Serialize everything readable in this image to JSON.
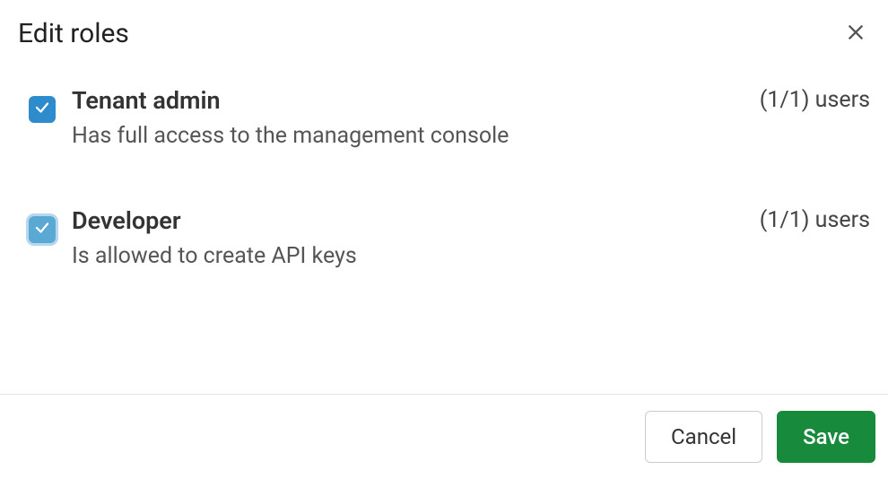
{
  "dialog": {
    "title": "Edit roles",
    "roles": [
      {
        "name": "Tenant admin",
        "description": "Has full access to the management console",
        "count": "(1/1) users",
        "state": "checked"
      },
      {
        "name": "Developer",
        "description": "Is allowed to create API keys",
        "count": "(1/1) users",
        "state": "mixed"
      }
    ],
    "buttons": {
      "cancel": "Cancel",
      "save": "Save"
    }
  }
}
